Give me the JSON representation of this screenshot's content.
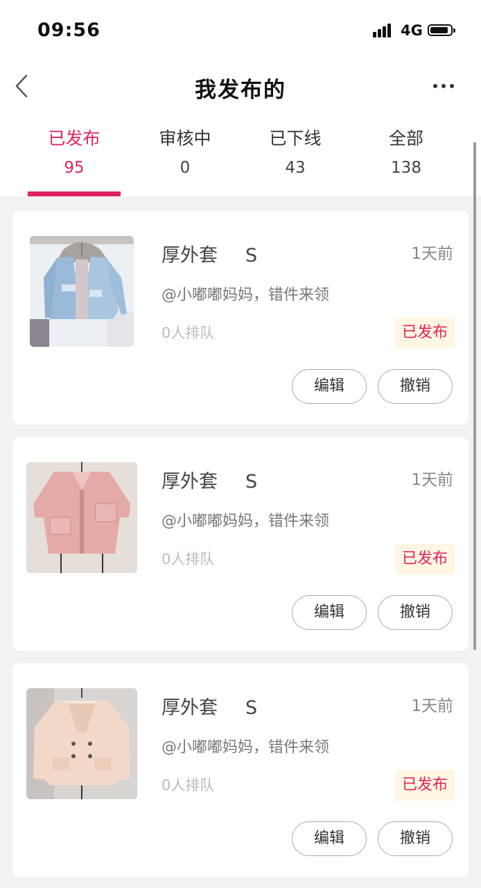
{
  "status_bar": {
    "time": "09:56",
    "network": "4G",
    "signal_icon": "signal-bars-icon",
    "battery_icon": "battery-icon"
  },
  "nav": {
    "title": "我发布的",
    "back_icon": "chevron-left-icon",
    "more_icon": "more-horizontal-icon"
  },
  "tabs": [
    {
      "label": "已发布",
      "count": "95",
      "active": true
    },
    {
      "label": "审核中",
      "count": "0",
      "active": false
    },
    {
      "label": "已下线",
      "count": "43",
      "active": false
    },
    {
      "label": "全部",
      "count": "138",
      "active": false
    }
  ],
  "accent_color": "#e0245e",
  "items": [
    {
      "name": "厚外套",
      "size": "S",
      "time_ago": "1天前",
      "description": "@小嘟嘟妈妈，错件来领",
      "queue": "0人排队",
      "status": "已发布",
      "edit_label": "编辑",
      "cancel_label": "撤销",
      "image": "denim-jacket-photo"
    },
    {
      "name": "厚外套",
      "size": "S",
      "time_ago": "1天前",
      "description": "@小嘟嘟妈妈，错件来领",
      "queue": "0人排队",
      "status": "已发布",
      "edit_label": "编辑",
      "cancel_label": "撤销",
      "image": "pink-coat-photo"
    },
    {
      "name": "厚外套",
      "size": "S",
      "time_ago": "1天前",
      "description": "@小嘟嘟妈妈，错件来领",
      "queue": "0人排队",
      "status": "已发布",
      "edit_label": "编辑",
      "cancel_label": "撤销",
      "image": "beige-teddy-coat-photo"
    }
  ]
}
